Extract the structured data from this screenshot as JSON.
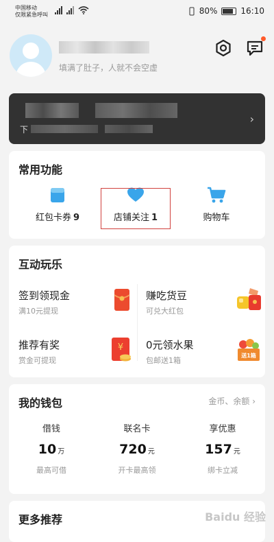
{
  "status_bar": {
    "carrier_line1": "中国移动",
    "carrier_line2": "仅限紧急呼叫",
    "signal_label": "4G",
    "battery": "80%",
    "time": "16:10"
  },
  "profile": {
    "motto": "填满了肚子，人就不会空虚"
  },
  "vip_banner": {
    "prefix": "下"
  },
  "common": {
    "title": "常用功能",
    "items": [
      {
        "label": "红包卡券",
        "count": "9",
        "icon": "red-packet-card-icon"
      },
      {
        "label": "店铺关注",
        "count": "1",
        "icon": "heart-icon"
      },
      {
        "label": "购物车",
        "count": "",
        "icon": "shopping-cart-icon"
      }
    ]
  },
  "fun": {
    "title": "互动玩乐",
    "items": [
      {
        "title": "签到领现金",
        "sub": "满10元提现",
        "icon": "red-envelope-icon"
      },
      {
        "title": "赚吃货豆",
        "sub": "可兑大红包",
        "icon": "beans-icon"
      },
      {
        "title": "推荐有奖",
        "sub": "赏金可提现",
        "icon": "yuan-envelope-icon"
      },
      {
        "title": "0元领水果",
        "sub": "包邮送1箱",
        "icon": "fruit-box-icon"
      }
    ],
    "fruit_badge": "送1箱"
  },
  "wallet": {
    "title": "我的钱包",
    "more": "金币、余额",
    "items": [
      {
        "label": "借钱",
        "value": "10",
        "unit": "万",
        "desc": "最高可借"
      },
      {
        "label": "联名卡",
        "value": "720",
        "unit": "元",
        "desc": "开卡最高领"
      },
      {
        "label": "享优惠",
        "value": "157",
        "unit": "元",
        "desc": "绑卡立减"
      }
    ]
  },
  "more": {
    "title": "更多推荐"
  },
  "watermark": "Baidu 经验",
  "colors": {
    "accent_blue": "#3aa5ea",
    "highlight_red": "#d0403c",
    "badge_orange": "#ff5a2a"
  }
}
